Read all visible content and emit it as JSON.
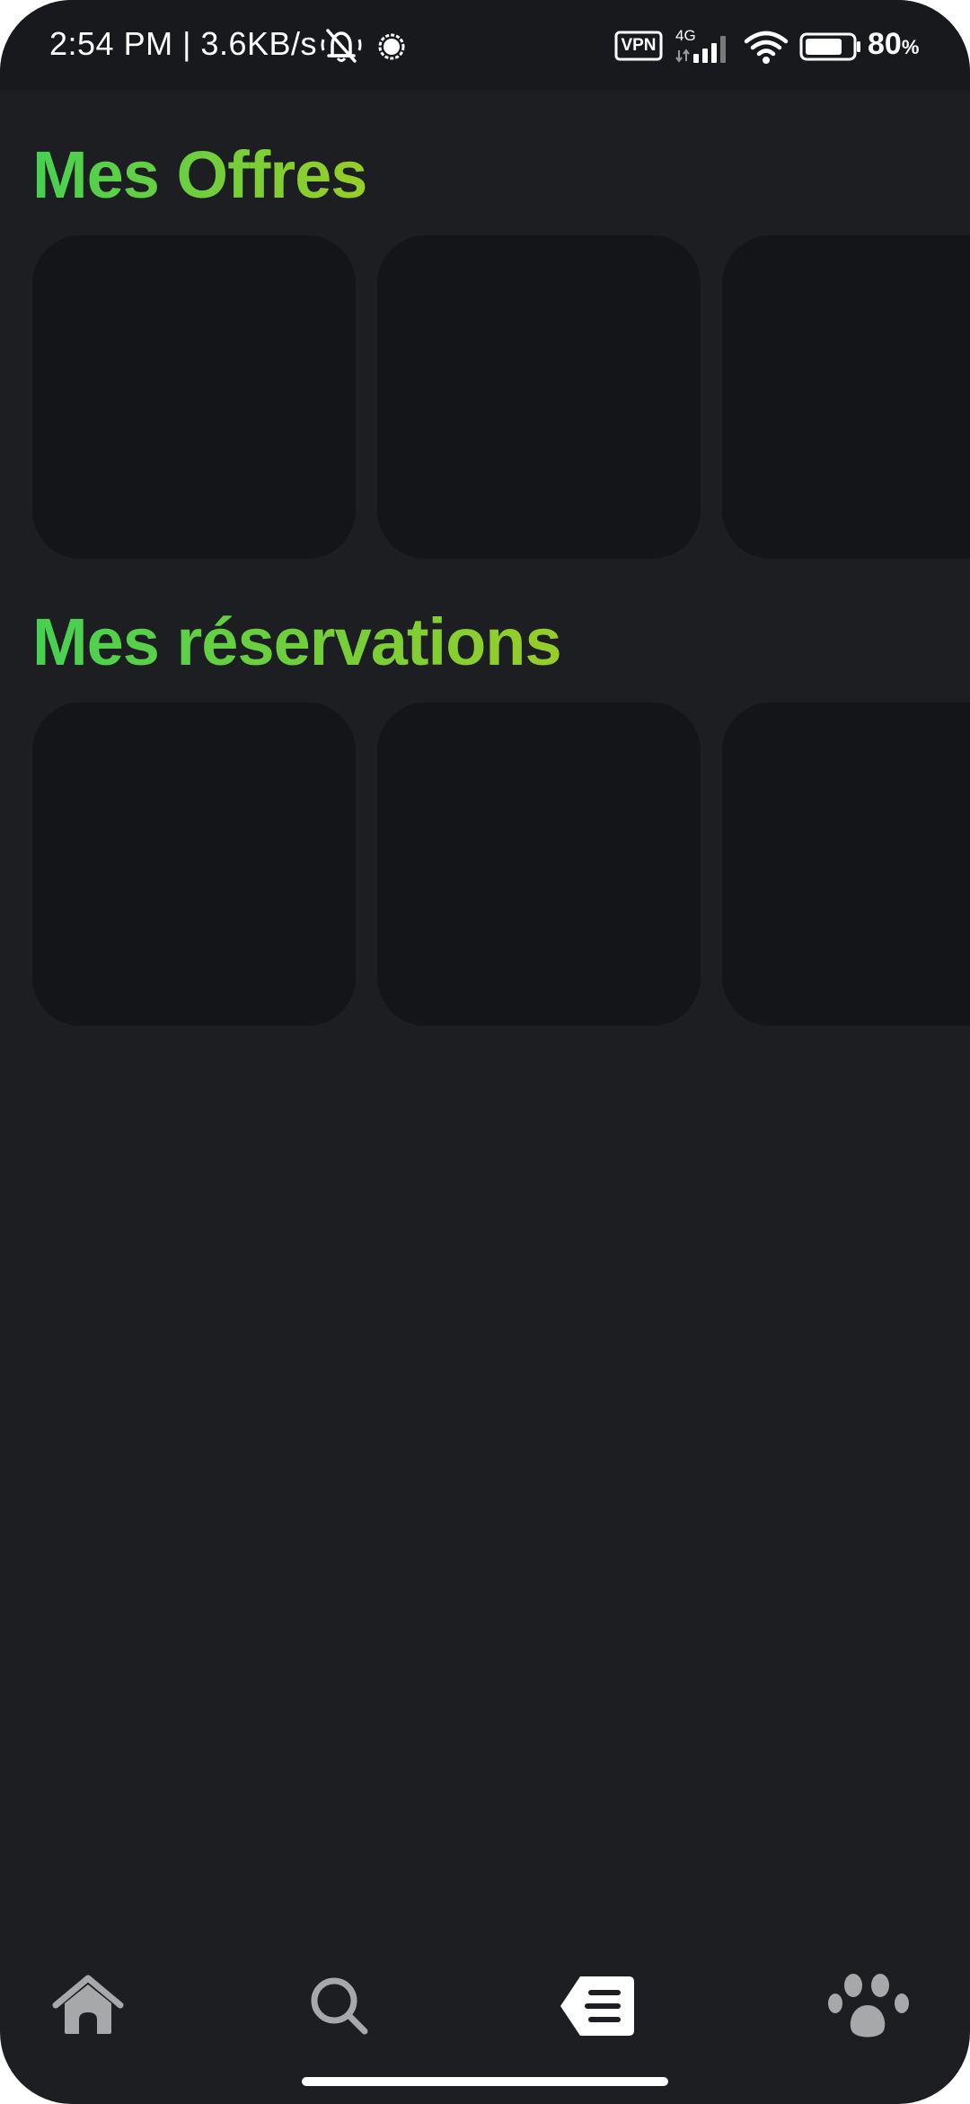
{
  "status_bar": {
    "time_and_speed": "2:54 PM | 3.6KB/s",
    "vpn_label": "VPN",
    "network_label": "4G",
    "battery_value": "80",
    "battery_unit": "%",
    "battery_level": 0.8
  },
  "sections": {
    "offers": {
      "title": "Mes Offres",
      "cards": 3
    },
    "reservations": {
      "title": "Mes réservations",
      "cards": 3
    }
  },
  "bottom_nav": {
    "items": [
      {
        "icon": "home-icon",
        "active": false
      },
      {
        "icon": "search-icon",
        "active": false
      },
      {
        "icon": "offers-tag-icon",
        "active": true
      },
      {
        "icon": "paw-icon",
        "active": false
      }
    ]
  },
  "colors": {
    "background": "#1c1e22",
    "card": "#141518",
    "title_gradient_start": "#47d052",
    "title_gradient_end": "#98cd28",
    "nav_inactive": "#a7a8aa",
    "nav_active": "#ffffff"
  }
}
